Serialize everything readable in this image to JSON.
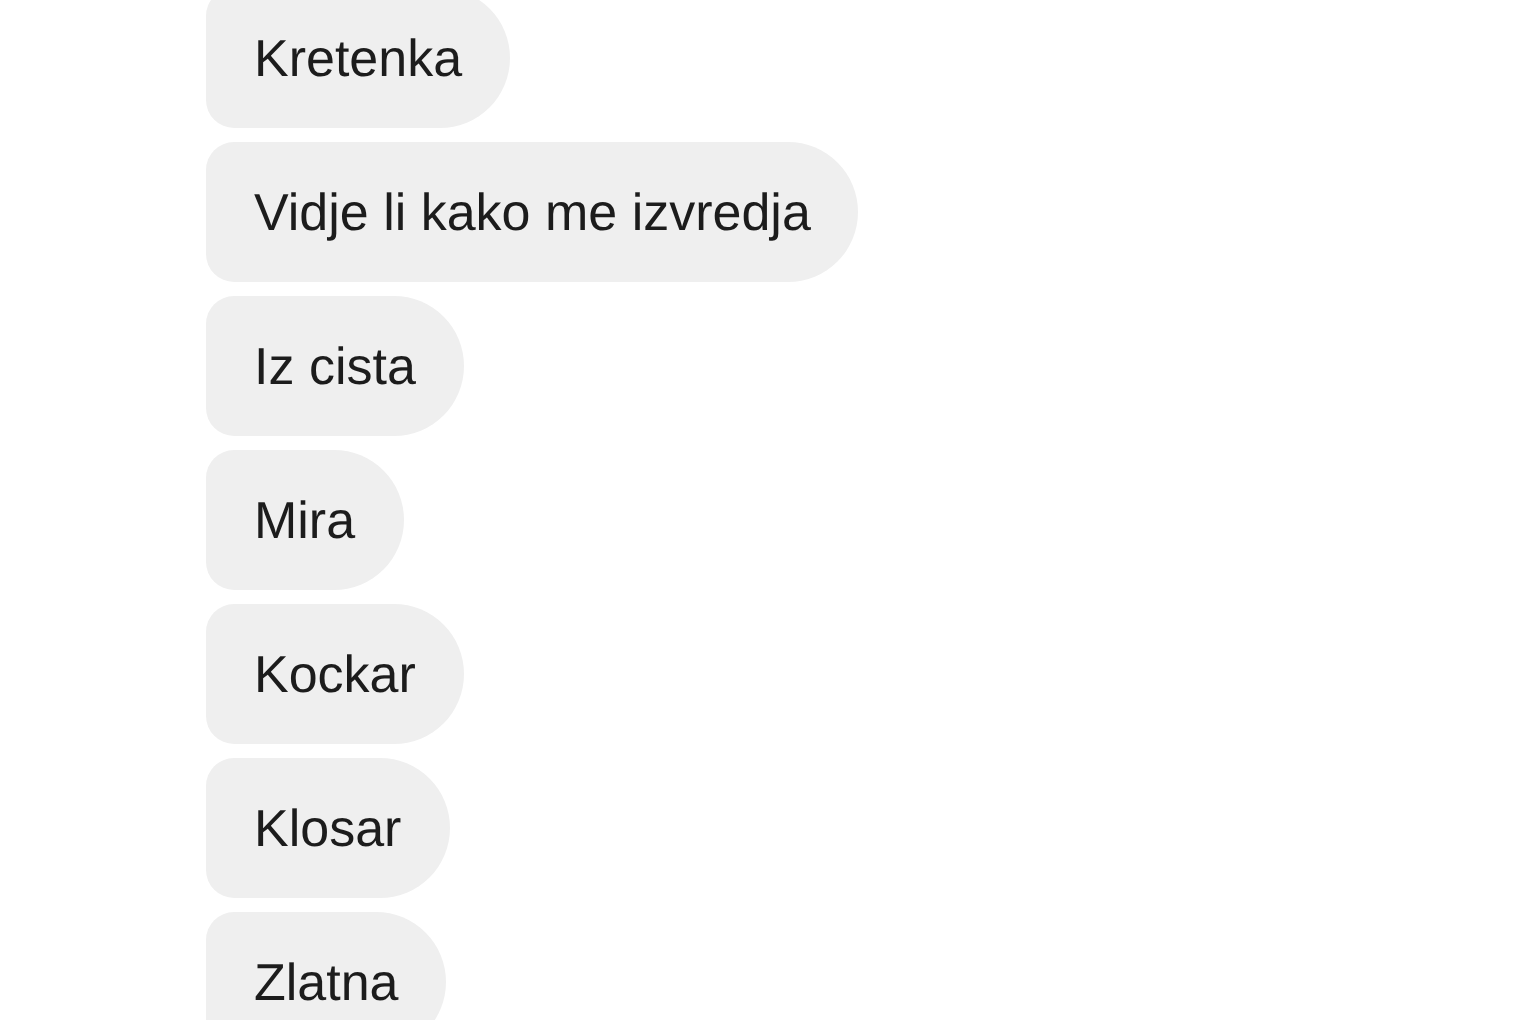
{
  "messages": [
    {
      "text": "Kretenka"
    },
    {
      "text": "Vidje li kako me izvredja"
    },
    {
      "text": "Iz cista"
    },
    {
      "text": "Mira"
    },
    {
      "text": "Kockar"
    },
    {
      "text": "Klosar"
    },
    {
      "text": "Zlatna"
    }
  ]
}
